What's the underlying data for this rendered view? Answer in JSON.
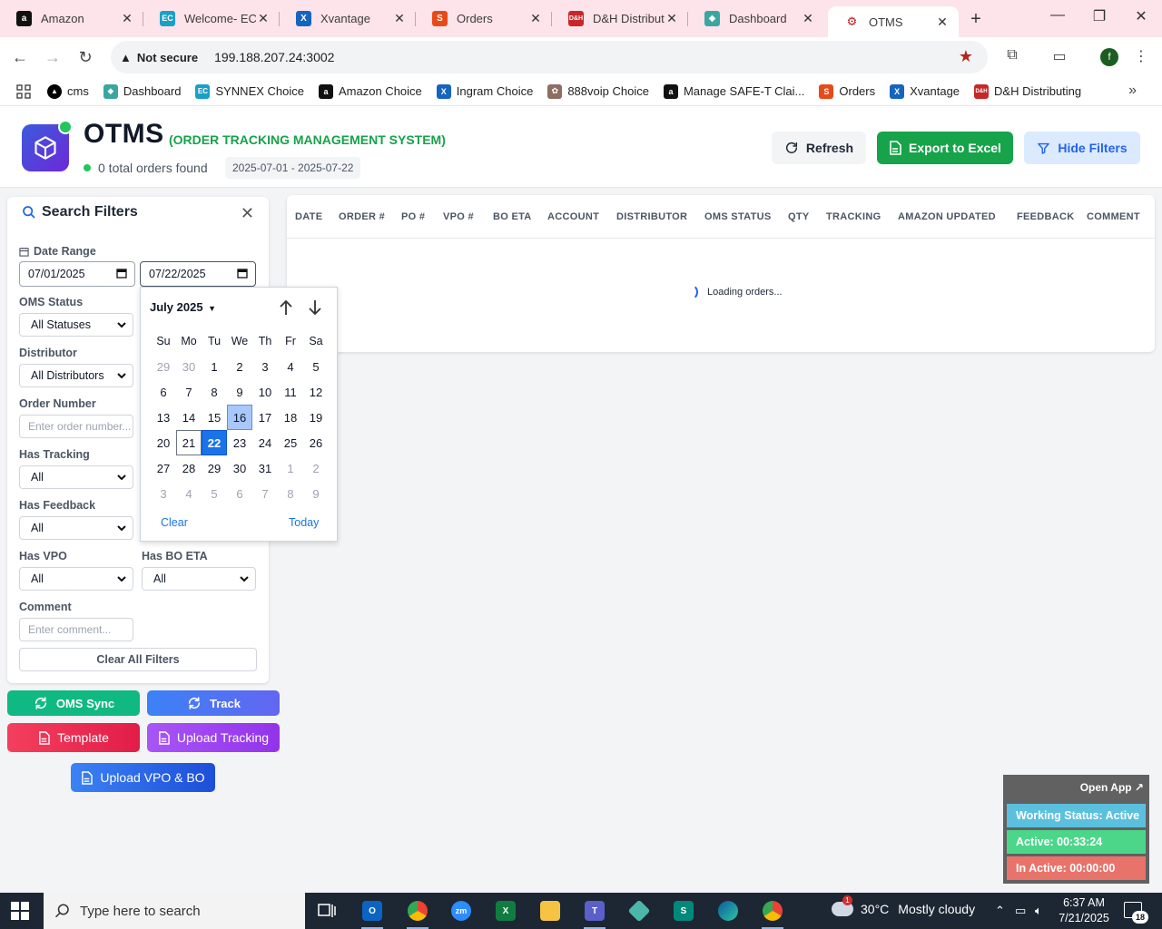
{
  "browser": {
    "tabs": [
      {
        "label": "Amazon",
        "icon": "amazon-icon",
        "color": "#111111",
        "glyph": "a"
      },
      {
        "label": "Welcome- ECE",
        "icon": "ec-icon",
        "color": "#1aa0c8",
        "glyph": "EC"
      },
      {
        "label": "Xvantage",
        "icon": "xvantage-icon",
        "color": "#1565c0",
        "glyph": "X"
      },
      {
        "label": "Orders",
        "icon": "orders-icon",
        "color": "#e64a19",
        "glyph": "S"
      },
      {
        "label": "D&H Distributi",
        "icon": "dh-icon",
        "color": "#c62828",
        "glyph": "D&H"
      },
      {
        "label": "Dashboard",
        "icon": "dashboard-icon",
        "color": "#3aa6a1",
        "glyph": "◆"
      },
      {
        "label": "OTMS",
        "icon": "otms-tab-icon",
        "color": "#6b7280",
        "glyph": "⚙"
      }
    ],
    "not_secure": "Not secure",
    "url": "199.188.207.24:3002",
    "profile_initial": "f",
    "bookmarks": [
      {
        "label": "cms",
        "color": "#000000",
        "glyph": "▲"
      },
      {
        "label": "Dashboard",
        "color": "#3aa6a1",
        "glyph": "◆"
      },
      {
        "label": "SYNNEX Choice",
        "color": "#1aa0c8",
        "glyph": "EC"
      },
      {
        "label": "Amazon Choice",
        "color": "#111111",
        "glyph": "a"
      },
      {
        "label": "Ingram Choice",
        "color": "#1565c0",
        "glyph": "X"
      },
      {
        "label": "888voip Choice",
        "color": "#8d6e63",
        "glyph": "✿"
      },
      {
        "label": "Manage SAFE-T Clai...",
        "color": "#111111",
        "glyph": "a"
      },
      {
        "label": "Orders",
        "color": "#e64a19",
        "glyph": "S"
      },
      {
        "label": "Xvantage",
        "color": "#1565c0",
        "glyph": "X"
      },
      {
        "label": "D&H Distributing",
        "color": "#c62828",
        "glyph": "D&H"
      }
    ]
  },
  "header": {
    "title": "OTMS",
    "subtitle": "(ORDER TRACKING MANAGEMENT SYSTEM)",
    "order_count": "0 total orders found",
    "date_range": "2025-07-01 - 2025-07-22",
    "refresh_label": "Refresh",
    "export_label": "Export to Excel",
    "hide_filters_label": "Hide Filters"
  },
  "filters": {
    "title": "Search Filters",
    "date_range_label": "Date Range",
    "date_from": "07/01/2025",
    "date_to": "07/22/2025",
    "oms_status_label": "OMS Status",
    "oms_status_value": "All Statuses",
    "distributor_label": "Distributor",
    "distributor_value": "All Distributors",
    "order_number_label": "Order Number",
    "order_number_placeholder": "Enter order number...",
    "has_tracking_label": "Has Tracking",
    "has_tracking_value": "All",
    "has_feedback_label": "Has Feedback",
    "has_feedback_value": "All",
    "has_vpo_label": "Has VPO",
    "has_vpo_value": "All",
    "has_bo_eta_label": "Has BO ETA",
    "has_bo_eta_value": "All",
    "comment_label": "Comment",
    "comment_placeholder": "Enter comment...",
    "clear_all_label": "Clear All Filters"
  },
  "actions": {
    "oms_sync": "OMS Sync",
    "track": "Track",
    "template": "Template",
    "upload_tracking": "Upload Tracking",
    "upload_vpo_bo": "Upload VPO & BO"
  },
  "calendar": {
    "month_label": "July 2025",
    "weekdays": [
      "Su",
      "Mo",
      "Tu",
      "We",
      "Th",
      "Fr",
      "Sa"
    ],
    "weeks": [
      [
        {
          "d": "29",
          "m": true
        },
        {
          "d": "30",
          "m": true
        },
        {
          "d": "1"
        },
        {
          "d": "2"
        },
        {
          "d": "3"
        },
        {
          "d": "4"
        },
        {
          "d": "5"
        }
      ],
      [
        {
          "d": "6"
        },
        {
          "d": "7"
        },
        {
          "d": "8"
        },
        {
          "d": "9"
        },
        {
          "d": "10"
        },
        {
          "d": "11"
        },
        {
          "d": "12"
        }
      ],
      [
        {
          "d": "13"
        },
        {
          "d": "14"
        },
        {
          "d": "15"
        },
        {
          "d": "16",
          "s": "hover"
        },
        {
          "d": "17"
        },
        {
          "d": "18"
        },
        {
          "d": "19"
        }
      ],
      [
        {
          "d": "20"
        },
        {
          "d": "21",
          "s": "today"
        },
        {
          "d": "22",
          "s": "selected"
        },
        {
          "d": "23"
        },
        {
          "d": "24"
        },
        {
          "d": "25"
        },
        {
          "d": "26"
        }
      ],
      [
        {
          "d": "27"
        },
        {
          "d": "28"
        },
        {
          "d": "29"
        },
        {
          "d": "30"
        },
        {
          "d": "31"
        },
        {
          "d": "1",
          "m": true
        },
        {
          "d": "2",
          "m": true
        }
      ],
      [
        {
          "d": "3",
          "m": true
        },
        {
          "d": "4",
          "m": true
        },
        {
          "d": "5",
          "m": true
        },
        {
          "d": "6",
          "m": true
        },
        {
          "d": "7",
          "m": true
        },
        {
          "d": "8",
          "m": true
        },
        {
          "d": "9",
          "m": true
        }
      ]
    ],
    "clear_label": "Clear",
    "today_label": "Today"
  },
  "table": {
    "columns": [
      "DATE",
      "ORDER #",
      "PO #",
      "VPO #",
      "BO ETA",
      "ACCOUNT",
      "DISTRIBUTOR",
      "OMS STATUS",
      "QTY",
      "TRACKING",
      "AMAZON UPDATED",
      "FEEDBACK",
      "COMMENT"
    ],
    "loading_text": "Loading orders..."
  },
  "widget": {
    "open_app": "Open App ↗",
    "working_status": "Working Status: Active",
    "active": "Active: 00:33:24",
    "inactive": "In Active: 00:00:00"
  },
  "taskbar": {
    "search_placeholder": "Type here to search",
    "weather_temp": "30°C",
    "weather_desc": "Mostly cloudy",
    "weather_badge": "1",
    "time": "6:37 AM",
    "date": "7/21/2025",
    "notification_count": "18"
  },
  "colors": {
    "green": "#16a34a",
    "blue_filter": "#dbeafe",
    "oms_sync": "#10b981",
    "track": "#3b82f6",
    "template": "#f43f5e",
    "upload_tracking": "#a855f7",
    "upload_vpo": "#2563eb"
  }
}
